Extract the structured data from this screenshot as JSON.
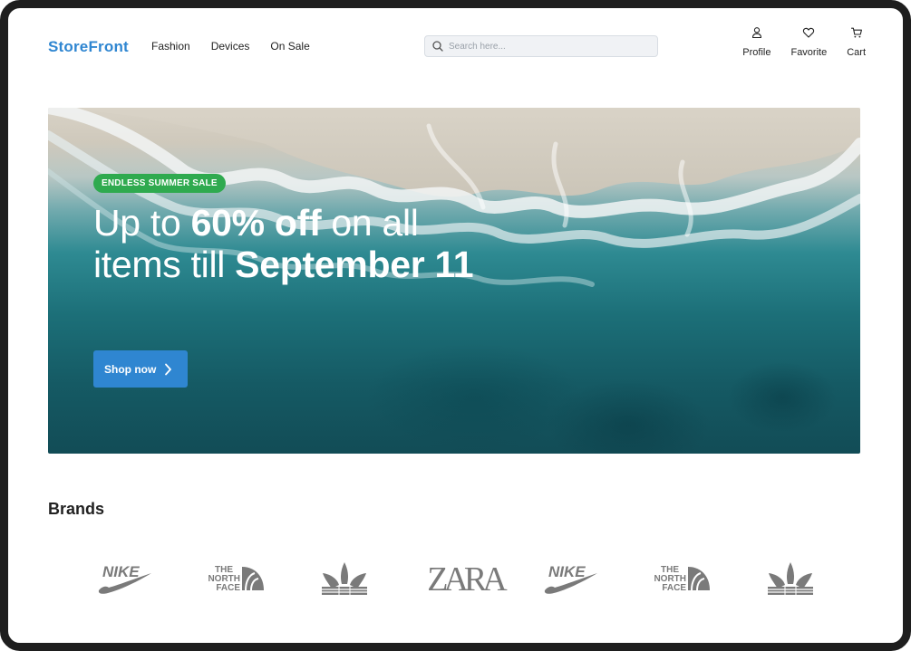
{
  "header": {
    "logo": "StoreFront",
    "nav": [
      "Fashion",
      "Devices",
      "On Sale"
    ],
    "search_placeholder": "Search here...",
    "actions": [
      {
        "label": "Profile",
        "icon": "user-icon"
      },
      {
        "label": "Favorite",
        "icon": "heart-icon"
      },
      {
        "label": "Cart",
        "icon": "cart-icon"
      }
    ]
  },
  "hero": {
    "badge": "ENDLESS SUMMER SALE",
    "headline_pre": "Up to ",
    "headline_bold1": "60% off",
    "headline_mid": " on all items till ",
    "headline_bold2": "September 11",
    "cta_label": "Shop now",
    "cta_icon": "chevron-right-icon"
  },
  "brands": {
    "title": "Brands",
    "items": [
      {
        "name": "nike",
        "text": "NIKE"
      },
      {
        "name": "the-north-face",
        "lines": [
          "THE",
          "NORTH",
          "FACE"
        ]
      },
      {
        "name": "adidas"
      },
      {
        "name": "zara",
        "text": "ZARA"
      },
      {
        "name": "nike",
        "text": "NIKE"
      },
      {
        "name": "the-north-face",
        "lines": [
          "THE",
          "NORTH",
          "FACE"
        ]
      },
      {
        "name": "adidas"
      }
    ]
  },
  "colors": {
    "accent": "#2f86d1",
    "badge_green": "#2faa4f",
    "brand_gray": "#7a7a7a",
    "frame": "#1e1e1e"
  }
}
